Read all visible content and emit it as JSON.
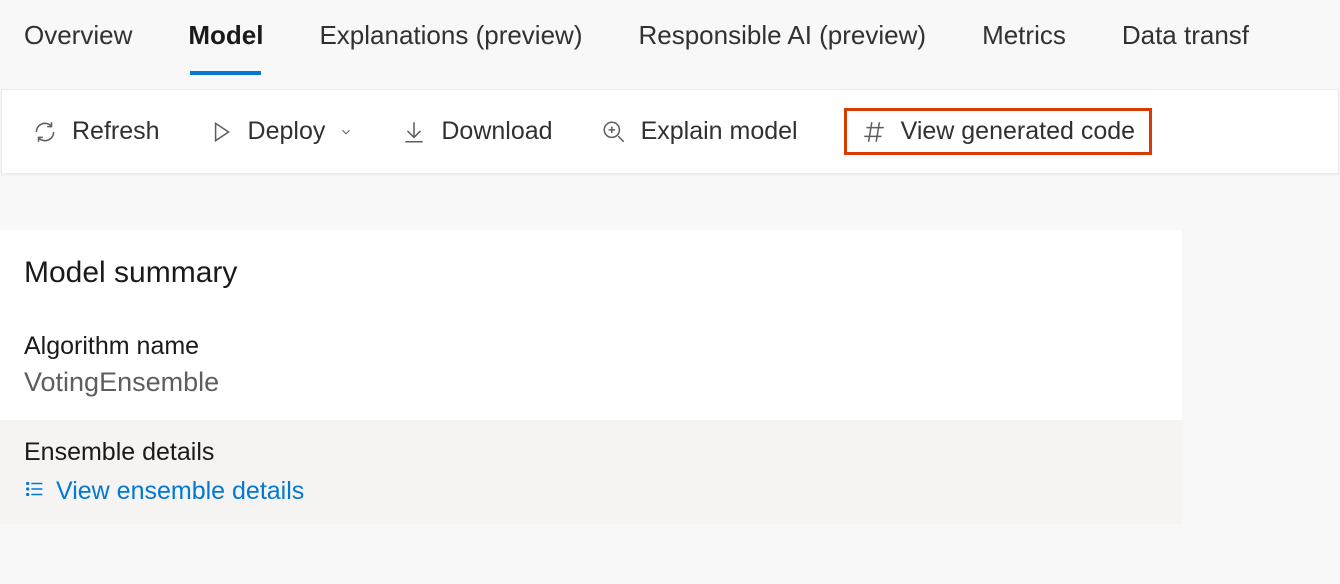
{
  "tabs": {
    "overview": "Overview",
    "model": "Model",
    "explanations": "Explanations (preview)",
    "responsible_ai": "Responsible AI (preview)",
    "metrics": "Metrics",
    "data_transf": "Data transf"
  },
  "toolbar": {
    "refresh": "Refresh",
    "deploy": "Deploy",
    "download": "Download",
    "explain_model": "Explain model",
    "view_generated_code": "View generated code"
  },
  "summary": {
    "title": "Model summary",
    "algorithm_name_label": "Algorithm name",
    "algorithm_name_value": "VotingEnsemble",
    "ensemble_details_label": "Ensemble details",
    "view_ensemble_link": "View ensemble details"
  }
}
